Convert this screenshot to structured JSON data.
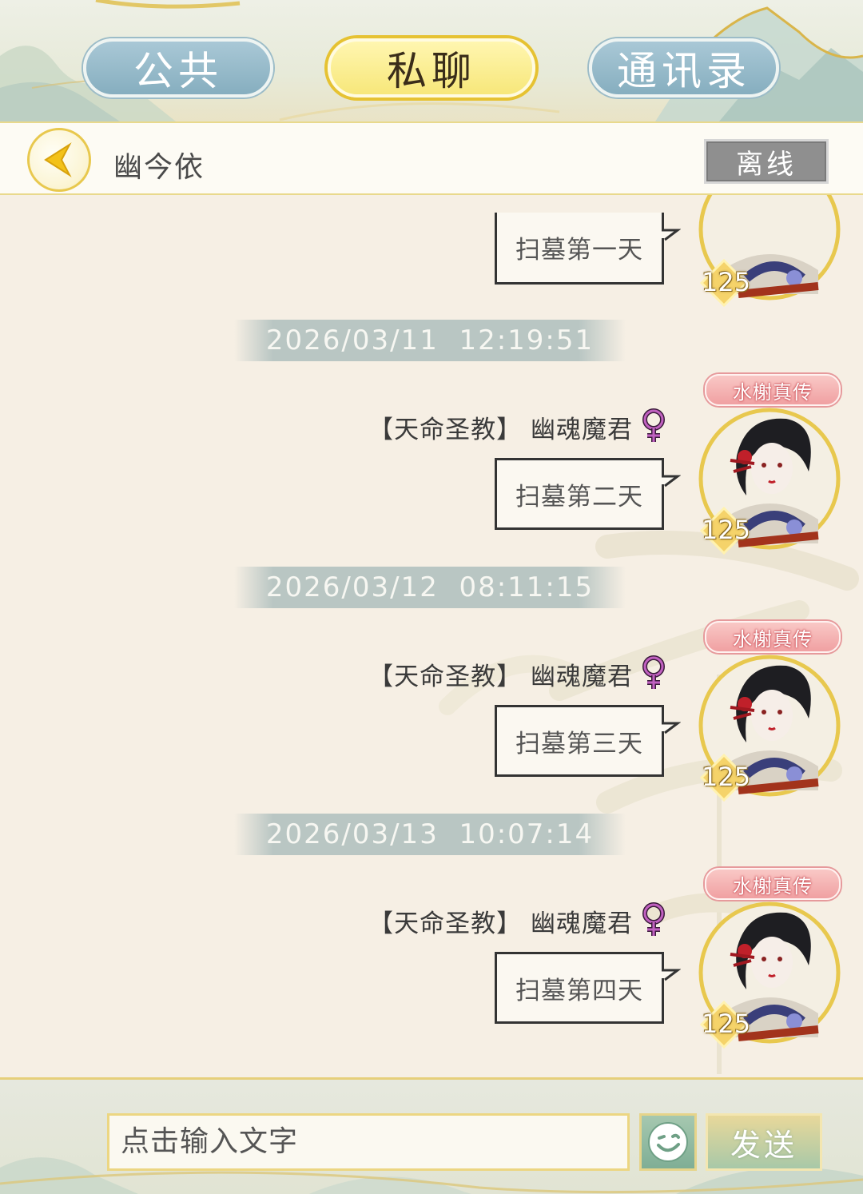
{
  "tabs": [
    {
      "label": "公共",
      "active": false
    },
    {
      "label": "私聊",
      "active": true
    },
    {
      "label": "通讯录",
      "active": false
    }
  ],
  "titlebar": {
    "contact_name": "幽今依",
    "status": "离线"
  },
  "messages": [
    {
      "timestamp": "",
      "sender": "",
      "title_tag": "",
      "level": "125",
      "text": "扫墓第一天"
    },
    {
      "timestamp": "2026/03/11  12:19:51",
      "sender": "【天命圣教】 幽魂魔君",
      "title_tag": "水榭真传",
      "level": "125",
      "text": "扫墓第二天"
    },
    {
      "timestamp": "2026/03/12  08:11:15",
      "sender": "【天命圣教】 幽魂魔君",
      "title_tag": "水榭真传",
      "level": "125",
      "text": "扫墓第三天"
    },
    {
      "timestamp": "2026/03/13  10:07:14",
      "sender": "【天命圣教】 幽魂魔君",
      "title_tag": "水榭真传",
      "level": "125",
      "text": "扫墓第四天"
    }
  ],
  "input": {
    "placeholder": "点击输入文字",
    "send_label": "发送"
  },
  "colors": {
    "accent_gold": "#e6c232",
    "tab_blue": "#86aebf",
    "gender_female": "#b04ab0",
    "title_tag_pink": "#f0a0a2"
  },
  "icons": {
    "back": "chevron-left-icon",
    "gender": "female-symbol-icon",
    "emoji": "smiley-icon"
  }
}
